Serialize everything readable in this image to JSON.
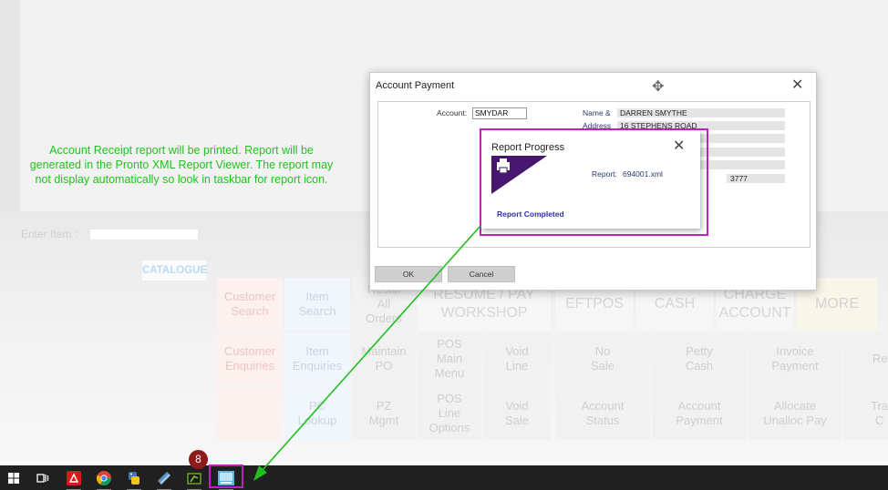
{
  "note": {
    "line1": "Account Receipt report will be printed.  Report will be",
    "line2": "generated in the Pronto XML Report Viewer.  The report may",
    "line3": "not display automatically so look in taskbar for report icon."
  },
  "entry": {
    "label": "Enter Item :"
  },
  "catalogue_label": "CATALOGUE",
  "tiles": {
    "customer_search": [
      "Customer",
      "Search"
    ],
    "item_search": [
      "Item",
      "Search"
    ],
    "recall_all_orders": [
      "Recall",
      "All",
      "Orders"
    ],
    "resume_pay_workshop": [
      "RESUME / PAY",
      "WORKSHOP"
    ],
    "eftpos": "EFTPOS",
    "cash": "CASH",
    "charge_account": [
      "CHARGE",
      "ACCOUNT"
    ],
    "more": "MORE",
    "customer_enquiries": [
      "Customer",
      "Enquiries"
    ],
    "item_enquiries": [
      "Item",
      "Enquiries"
    ],
    "maintain_po": [
      "Maintain",
      "PO"
    ],
    "pos_main_menu": [
      "POS",
      "Main",
      "Menu"
    ],
    "void_line": [
      "Void",
      "Line"
    ],
    "no_sale": [
      "No",
      "Sale"
    ],
    "petty_cash": [
      "Petty",
      "Cash"
    ],
    "invoice_payment": [
      "Invoice",
      "Payment"
    ],
    "reprint": [
      "Rep"
    ],
    "pc_lookup": [
      "PC",
      "Lookup"
    ],
    "pz_mgmt": [
      "PZ",
      "Mgmt"
    ],
    "pos_line_options": [
      "POS",
      "Line",
      "Options"
    ],
    "void_sale": [
      "Void",
      "Sale"
    ],
    "account_status": [
      "Account",
      "Status"
    ],
    "account_payment": [
      "Account",
      "Payment"
    ],
    "allocate_unalloc_pay": [
      "Allocate",
      "Unalloc Pay"
    ],
    "transfer": [
      "Tra",
      "C"
    ]
  },
  "dialog": {
    "title": "Account Payment",
    "account_label": "Account:",
    "account_value": "SMYDAR",
    "name_label": "Name &",
    "address_label": "Address",
    "name_value": "DARREN SMYTHE",
    "address_value": "16 STEPHENS ROAD",
    "extra_value": "3777",
    "ok_label": "OK",
    "cancel_label": "Cancel"
  },
  "report_progress": {
    "title": "Report Progress",
    "report_label": "Report:",
    "report_file": "694001.xml",
    "status": "Report Completed"
  },
  "taskbar": {
    "badge_count": "8",
    "icons": [
      "windows-start-icon",
      "task-view-icon",
      "acrobat-icon",
      "chrome-icon",
      "python-icon",
      "notepad-icon",
      "pronto-icon",
      "report-viewer-icon"
    ]
  },
  "colors": {
    "note_text": "#21c21f",
    "highlight_outline": "#bf21bf",
    "arrow": "#1fbf1f",
    "report_header": "#47176f",
    "status_text": "#2a2fb0",
    "taskbar": "#202020"
  }
}
